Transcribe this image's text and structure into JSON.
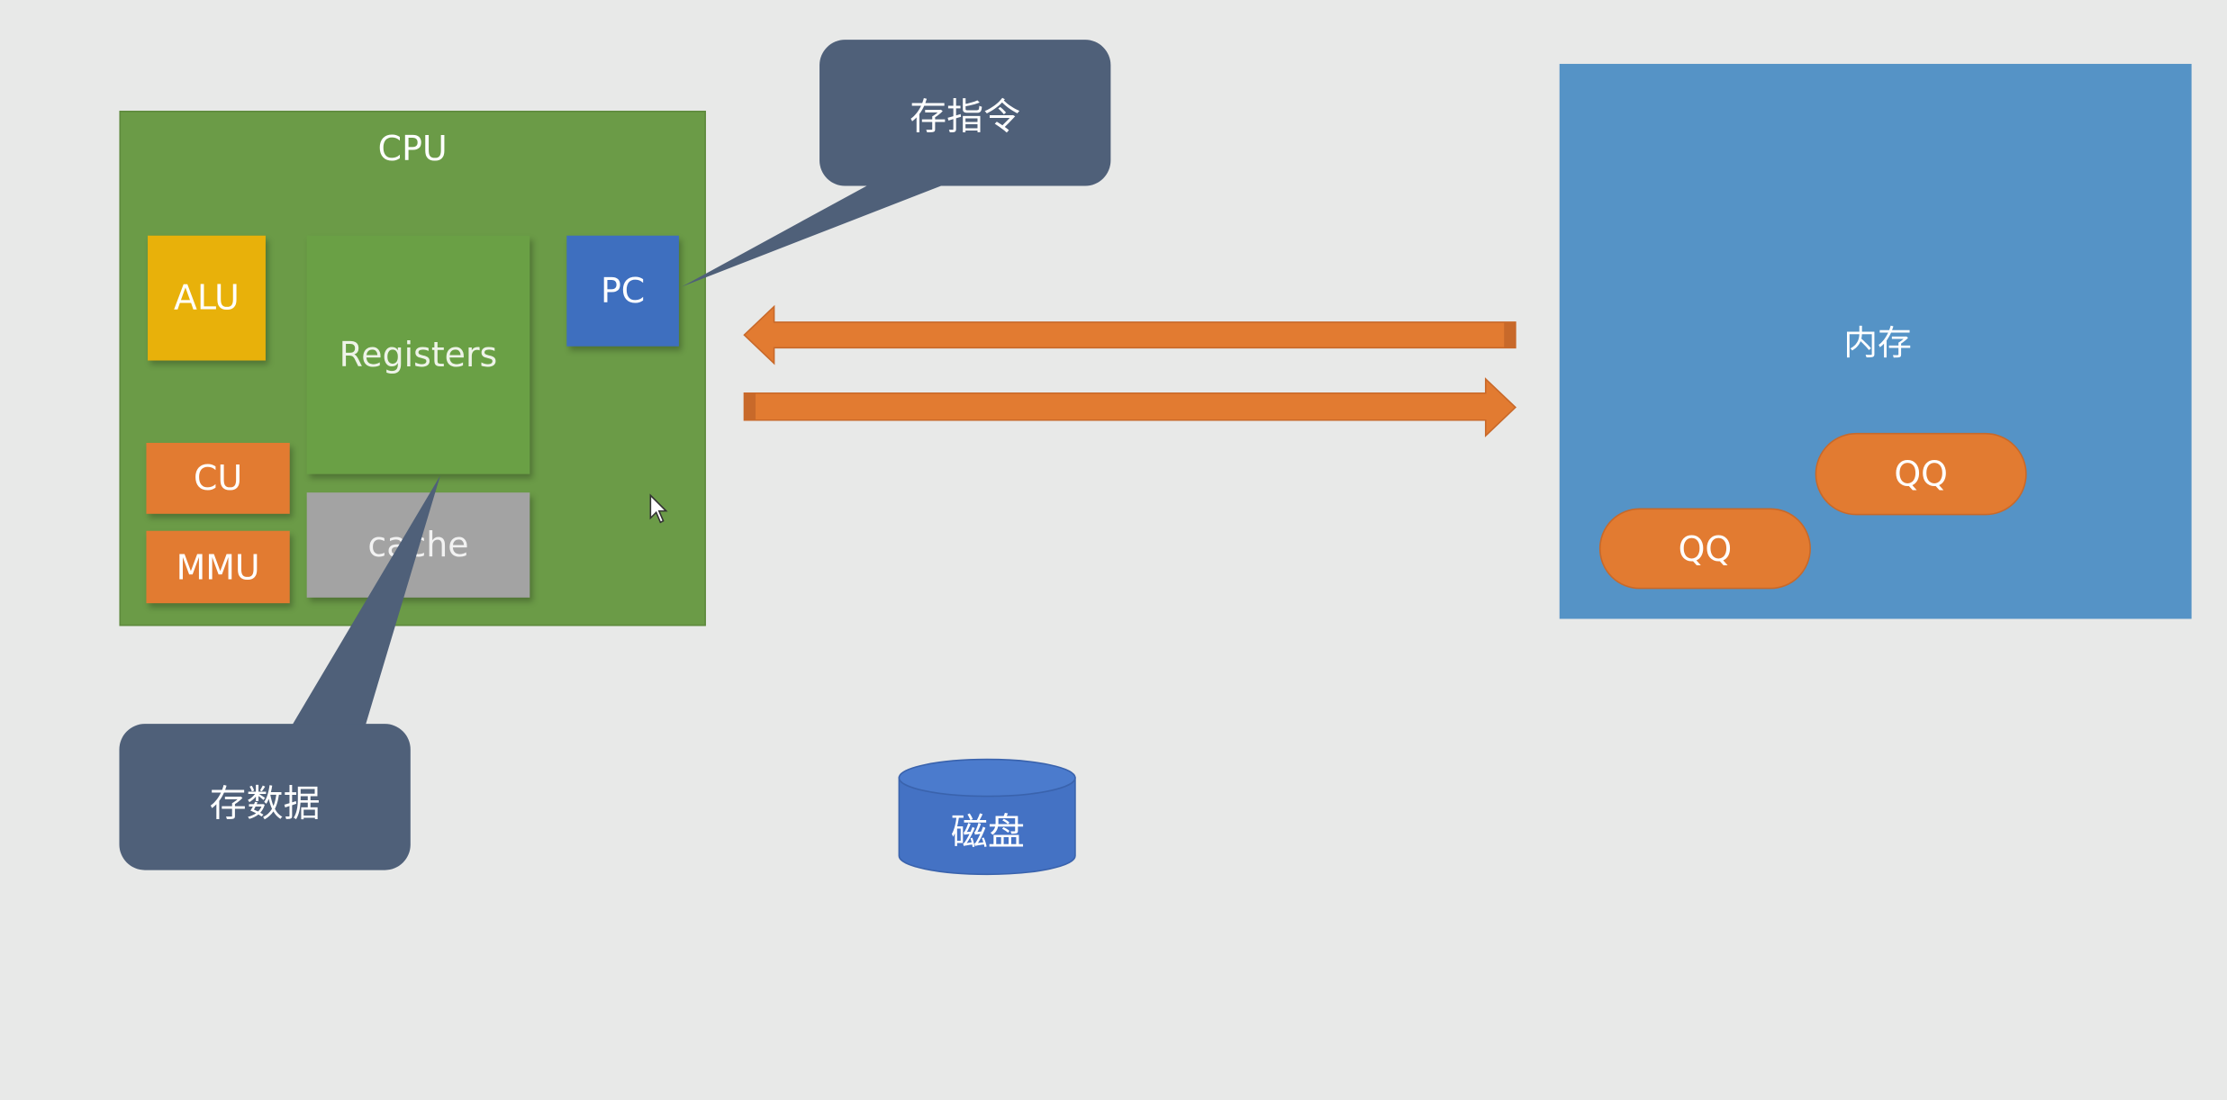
{
  "cpu": {
    "title": "CPU",
    "components": {
      "alu": "ALU",
      "registers": "Registers",
      "pc": "PC",
      "cu": "CU",
      "mmu": "MMU",
      "cache": "cache"
    }
  },
  "memory": {
    "label": "内存",
    "processes": [
      "QQ",
      "QQ"
    ]
  },
  "disk": {
    "label": "磁盘"
  },
  "callouts": {
    "pc": "存指令",
    "registers": "存数据"
  },
  "colors": {
    "background": "#e8e9e8",
    "cpu": "#6b9b47",
    "alu": "#e8b10a",
    "pc": "#3e6fbf",
    "orange": "#e27b31",
    "cache": "#a3a3a3",
    "memory": "#5593c6",
    "callout": "#4f6079",
    "disk": "#4472c4"
  }
}
